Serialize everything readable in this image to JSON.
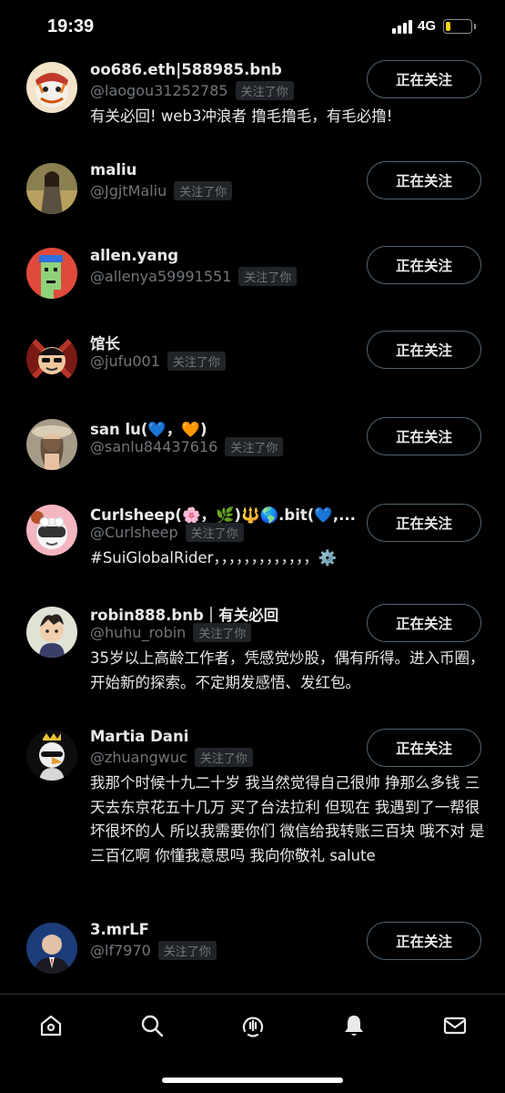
{
  "status_bar": {
    "time": "19:39",
    "network": "4G",
    "battery_level": 0.2
  },
  "follow_label": "正在关注",
  "follows_you_label": "关注了你",
  "users": [
    {
      "name": "oo686.eth|588985.bnb",
      "handle": "@laogou31252785",
      "bio": "有关必回! web3冲浪者 撸毛撸毛，有毛必撸!",
      "avatar_icon": "tiger-avatar"
    },
    {
      "name": "maliu",
      "handle": "@JgjtMaliu",
      "bio": "",
      "avatar_icon": "woman-photo-avatar"
    },
    {
      "name": "allen.yang",
      "handle": "@allenya59991551",
      "bio": "",
      "avatar_icon": "pixel-punk-avatar"
    },
    {
      "name": "馆长",
      "handle": "@jufu001",
      "bio": "",
      "avatar_icon": "cartoon-man-sunglasses-avatar"
    },
    {
      "name": "san lu(💙，🧡)",
      "handle": "@sanlu84437616",
      "bio": "",
      "avatar_icon": "woman-hat-avatar"
    },
    {
      "name": "Curlsheep(🌸，🌿)🔱🌎.bit(💙,...",
      "handle": "@Curlsheep",
      "bio": "#SuiGlobalRider，，，，，，，，，，，，，⚙️",
      "avatar_icon": "sheep-vr-avatar"
    },
    {
      "name": "robin888.bnb｜有关必回",
      "handle": "@huhu_robin",
      "bio": "35岁以上高龄工作者，凭感觉炒股，偶有所得。进入币圈，开始新的探索。不定期发感悟、发红包。",
      "avatar_icon": "cartoon-man-avatar"
    },
    {
      "name": "Martia Dani",
      "handle": "@zhuangwuc",
      "bio": "我那个时候十九二十岁 我当然觉得自己很帅 挣那么多钱 三天去东京花五十几万 买了台法拉利 但现在 我遇到了一帮很坏很坏的人 所以我需要你们 微信给我转账三百块 哦不对 是三百亿啊 你懂我意思吗 我向你敬礼 salute",
      "avatar_icon": "crowned-goose-avatar"
    },
    {
      "name": "3.mrLF",
      "handle": "@lf7970",
      "bio": "",
      "avatar_icon": "man-suit-avatar"
    }
  ],
  "tabbar": [
    {
      "icon": "home-icon"
    },
    {
      "icon": "search-icon"
    },
    {
      "icon": "spaces-icon"
    },
    {
      "icon": "notifications-icon"
    },
    {
      "icon": "messages-icon"
    }
  ]
}
